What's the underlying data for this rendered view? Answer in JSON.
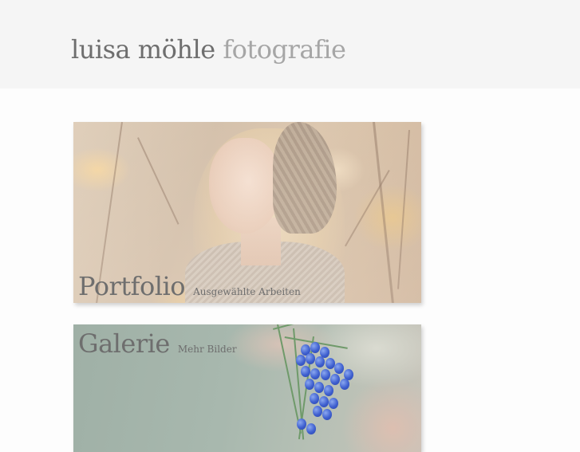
{
  "header": {
    "title_name": "luisa möhle",
    "title_sub": "fotografie"
  },
  "tiles": [
    {
      "title": "Portfolio",
      "subtitle": "Ausgewählte Arbeiten"
    },
    {
      "title": "Galerie",
      "subtitle": "Mehr Bilder"
    }
  ],
  "colors": {
    "header_bg": "#f5f5f5",
    "page_bg": "#fdfdfd",
    "title_dark": "#6e6e6e",
    "title_light": "#a6a6a6",
    "flower_blue": "#3e5fcf"
  }
}
